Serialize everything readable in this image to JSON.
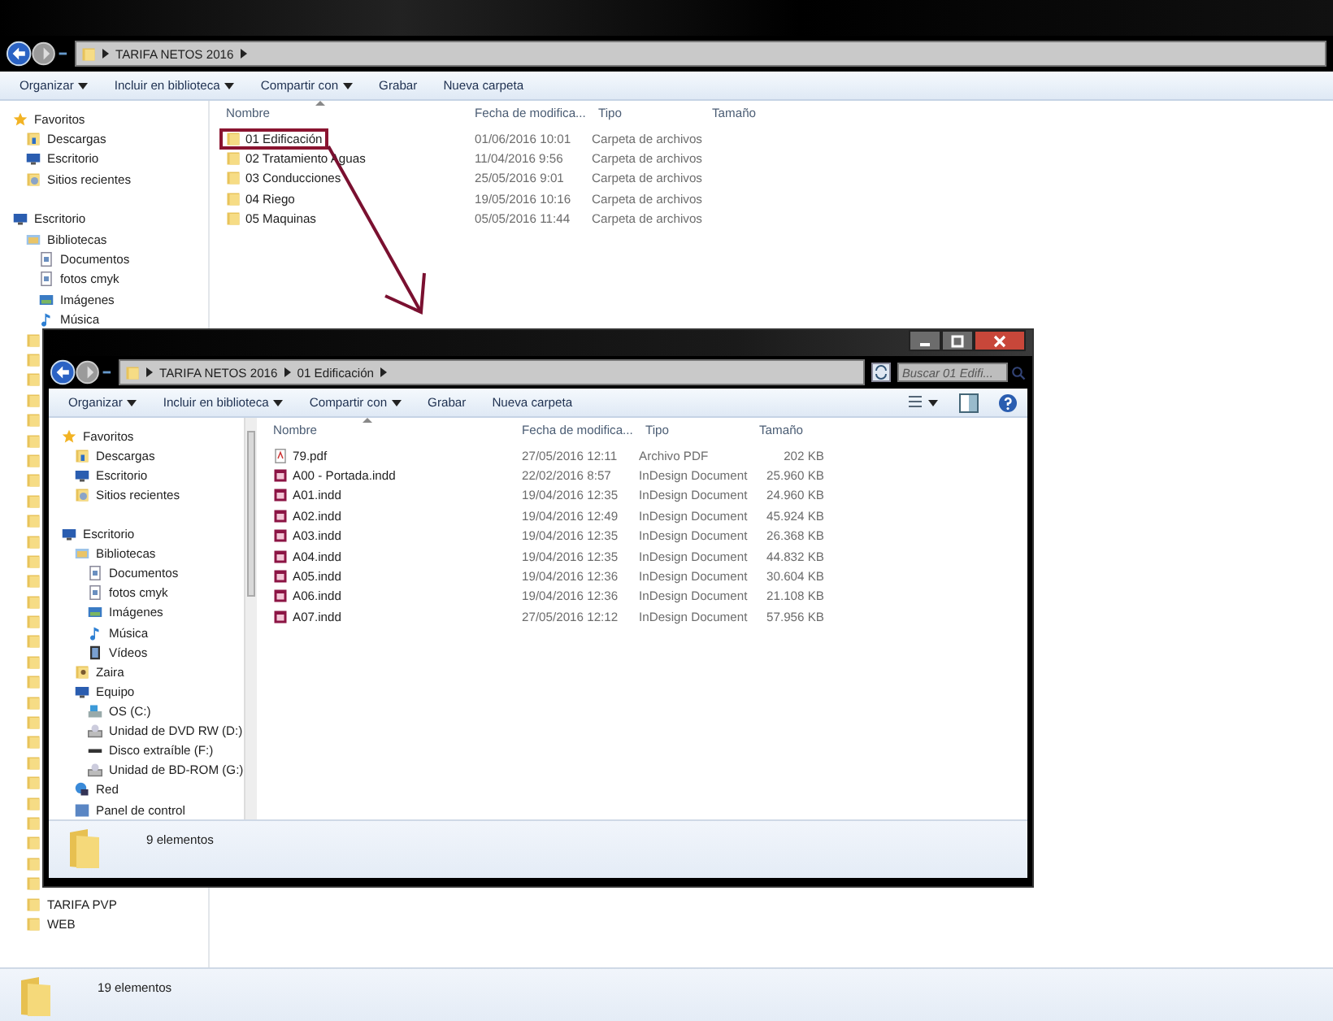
{
  "back_window": {
    "breadcrumb": [
      "TARIFA NETOS 2016"
    ],
    "toolbar": [
      {
        "label": "Organizar",
        "has_menu": true
      },
      {
        "label": "Incluir en biblioteca",
        "has_menu": true
      },
      {
        "label": "Compartir con",
        "has_menu": true
      },
      {
        "label": "Grabar",
        "has_menu": false
      },
      {
        "label": "Nueva carpeta",
        "has_menu": false
      }
    ],
    "nav": [
      {
        "label": "Favoritos",
        "kind": "star",
        "children": [
          {
            "label": "Descargas",
            "kind": "downloads"
          },
          {
            "label": "Escritorio",
            "kind": "desktop"
          },
          {
            "label": "Sitios recientes",
            "kind": "recent"
          }
        ]
      },
      {
        "label": "Escritorio",
        "kind": "desktop",
        "children": [
          {
            "label": "Bibliotecas",
            "kind": "library",
            "children": [
              {
                "label": "Documentos",
                "kind": "document"
              },
              {
                "label": "fotos cmyk",
                "kind": "document"
              },
              {
                "label": "Imágenes",
                "kind": "image"
              },
              {
                "label": "Música",
                "kind": "music"
              }
            ]
          }
        ]
      }
    ],
    "nav_bottom": [
      {
        "label": "TARIFA PVP",
        "kind": "folder"
      },
      {
        "label": "WEB",
        "kind": "folder"
      }
    ],
    "columns": [
      {
        "label": "Nombre",
        "sorted": true
      },
      {
        "label": "Fecha de modifica..."
      },
      {
        "label": "Tipo"
      },
      {
        "label": "Tamaño"
      }
    ],
    "files": [
      {
        "name": "01 Edificación",
        "date": "01/06/2016 10:01",
        "type": "Carpeta de archivos",
        "kind": "folder",
        "highlighted": true
      },
      {
        "name": "02 Tratamiento Aguas",
        "date": "11/04/2016 9:56",
        "type": "Carpeta de archivos",
        "kind": "folder",
        "highlighted": false
      },
      {
        "name": "03 Conducciones",
        "date": "25/05/2016 9:01",
        "type": "Carpeta de archivos",
        "kind": "folder",
        "highlighted": false
      },
      {
        "name": "04 Riego",
        "date": "19/05/2016 10:16",
        "type": "Carpeta de archivos",
        "kind": "folder",
        "highlighted": false
      },
      {
        "name": "05 Maquinas",
        "date": "05/05/2016 11:44",
        "type": "Carpeta de archivos",
        "kind": "folder",
        "highlighted": false
      }
    ],
    "status": "19 elementos"
  },
  "front_window": {
    "breadcrumb": [
      "TARIFA NETOS 2016",
      "01 Edificación"
    ],
    "search": {
      "placeholder": "Buscar 01 Edifi..."
    },
    "toolbar": [
      {
        "label": "Organizar",
        "has_menu": true
      },
      {
        "label": "Incluir en biblioteca",
        "has_menu": true
      },
      {
        "label": "Compartir con",
        "has_menu": true
      },
      {
        "label": "Grabar",
        "has_menu": false
      },
      {
        "label": "Nueva carpeta",
        "has_menu": false
      }
    ],
    "nav": [
      {
        "label": "Favoritos",
        "kind": "star",
        "children": [
          {
            "label": "Descargas",
            "kind": "downloads"
          },
          {
            "label": "Escritorio",
            "kind": "desktop"
          },
          {
            "label": "Sitios recientes",
            "kind": "recent"
          }
        ]
      },
      {
        "label": "Escritorio",
        "kind": "desktop",
        "children": [
          {
            "label": "Bibliotecas",
            "kind": "library",
            "children": [
              {
                "label": "Documentos",
                "kind": "document"
              },
              {
                "label": "fotos cmyk",
                "kind": "document"
              },
              {
                "label": "Imágenes",
                "kind": "image"
              },
              {
                "label": "Música",
                "kind": "music"
              },
              {
                "label": "Vídeos",
                "kind": "video"
              }
            ]
          },
          {
            "label": "Zaira",
            "kind": "user"
          },
          {
            "label": "Equipo",
            "kind": "computer",
            "children": [
              {
                "label": "OS (C:)",
                "kind": "os-drive"
              },
              {
                "label": "Unidad de DVD RW (D:)",
                "kind": "disc-drive"
              },
              {
                "label": "Disco extraíble (F:)",
                "kind": "removable"
              },
              {
                "label": "Unidad de BD-ROM (G:)",
                "kind": "disc-drive"
              }
            ]
          },
          {
            "label": "Red",
            "kind": "network"
          },
          {
            "label": "Panel de control",
            "kind": "control"
          }
        ]
      }
    ],
    "columns": [
      {
        "label": "Nombre",
        "sorted": true
      },
      {
        "label": "Fecha de modifica..."
      },
      {
        "label": "Tipo"
      },
      {
        "label": "Tamaño"
      }
    ],
    "files": [
      {
        "name": "79.pdf",
        "date": "27/05/2016 12:11",
        "type": "Archivo PDF",
        "size": "202 KB",
        "kind": "pdf"
      },
      {
        "name": "A00 - Portada.indd",
        "date": "22/02/2016 8:57",
        "type": "InDesign Document",
        "size": "25.960 KB",
        "kind": "indd"
      },
      {
        "name": "A01.indd",
        "date": "19/04/2016 12:35",
        "type": "InDesign Document",
        "size": "24.960 KB",
        "kind": "indd"
      },
      {
        "name": "A02.indd",
        "date": "19/04/2016 12:49",
        "type": "InDesign Document",
        "size": "45.924 KB",
        "kind": "indd"
      },
      {
        "name": "A03.indd",
        "date": "19/04/2016 12:35",
        "type": "InDesign Document",
        "size": "26.368 KB",
        "kind": "indd"
      },
      {
        "name": "A04.indd",
        "date": "19/04/2016 12:35",
        "type": "InDesign Document",
        "size": "44.832 KB",
        "kind": "indd"
      },
      {
        "name": "A05.indd",
        "date": "19/04/2016 12:36",
        "type": "InDesign Document",
        "size": "30.604 KB",
        "kind": "indd"
      },
      {
        "name": "A06.indd",
        "date": "19/04/2016 12:36",
        "type": "InDesign Document",
        "size": "21.108 KB",
        "kind": "indd"
      },
      {
        "name": "A07.indd",
        "date": "27/05/2016 12:12",
        "type": "InDesign Document",
        "size": "57.956 KB",
        "kind": "indd"
      }
    ],
    "status": "9 elementos"
  }
}
